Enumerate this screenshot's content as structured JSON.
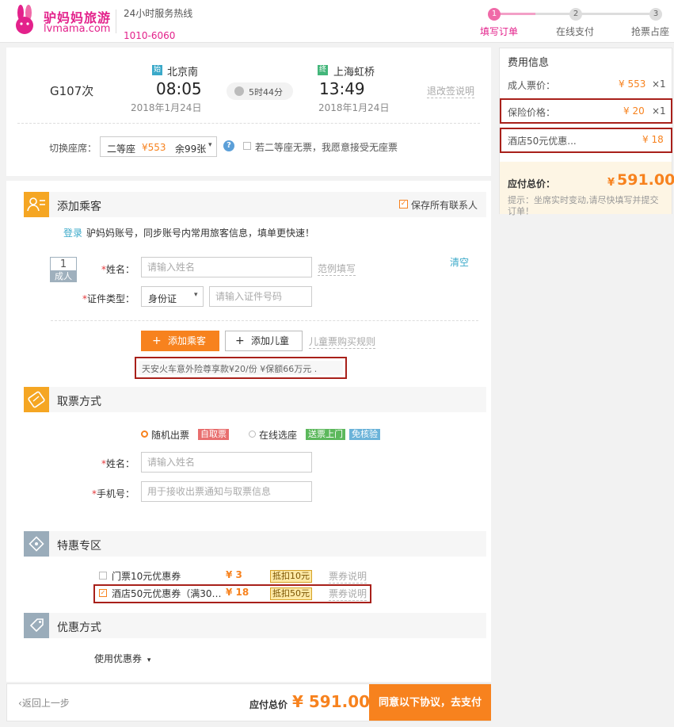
{
  "header": {
    "logo_cn": "驴妈妈旅游",
    "logo_en": "lvmama.com",
    "hotline_label": "24小时服务热线",
    "hotline_number": "1010-6060",
    "steps": [
      {
        "num": "1",
        "label": "填写订单"
      },
      {
        "num": "2",
        "label": "在线支付"
      },
      {
        "num": "3",
        "label": "抢票占座"
      }
    ]
  },
  "train": {
    "number": "G107次",
    "from_station": "北京南",
    "from_badge": "始",
    "depart_time": "08:05",
    "depart_date": "2018年1月24日",
    "duration": "5时44分",
    "to_station": "上海虹桥",
    "to_badge": "终",
    "arrive_time": "13:49",
    "arrive_date": "2018年1月24日",
    "refund_link": "退改签说明",
    "seat_label": "切换座席：",
    "seat_class": "二等座",
    "seat_price": "¥553",
    "seat_remain": "余99张",
    "no_seat_option": "若二等座无票，我愿意接受无座票"
  },
  "passenger": {
    "title": "添加乘客",
    "save_contacts": "保存所有联系人",
    "login_link": "登录",
    "login_hint": "驴妈妈账号，同步账号内常用旅客信息，填单更快速！",
    "index": "1",
    "index_type": "成人",
    "name_label": "姓名：",
    "name_placeholder": "请输入姓名",
    "example_link": "范例填写",
    "clear_link": "清空",
    "id_type_label": "证件类型：",
    "id_type_value": "身份证",
    "id_placeholder": "请输入证件号码",
    "add_passenger_btn": "添加乘客",
    "add_child_btn": "添加儿童",
    "child_rules": "儿童票购买规则",
    "insurance_text": "天安火车意外险尊享款¥20/份   ¥保额66万元 ."
  },
  "ticket": {
    "title": "取票方式",
    "option_random": "随机出票",
    "tag_self": "自取票",
    "option_online": "在线选座",
    "tag_deliver": "送票上门",
    "tag_free": "免核验",
    "name_label": "姓名：",
    "name_placeholder": "请输入姓名",
    "phone_label": "手机号：",
    "phone_placeholder": "用于接收出票通知与取票信息"
  },
  "deals": {
    "title": "特惠专区",
    "items": [
      {
        "name": "门票10元优惠券",
        "price": "¥ 3",
        "tag": "抵扣10元",
        "link": "票券说明"
      },
      {
        "name": "酒店50元优惠券（满30…",
        "price": "¥ 18",
        "tag": "抵扣50元",
        "link": "票券说明"
      }
    ]
  },
  "discount": {
    "title": "优惠方式",
    "coupon_label": "使用优惠券"
  },
  "bottom": {
    "back_link": "返回上一步",
    "total_label": "应付总价",
    "total_value": "¥ 591.00",
    "pay_button": "同意以下协议，去支付"
  },
  "sidebar": {
    "title": "费用信息",
    "rows": [
      {
        "label": "成人票价：",
        "price": "¥ 553",
        "qty": "×1"
      },
      {
        "label": "保险价格：",
        "price": "¥ 20",
        "qty": "×1"
      },
      {
        "label": "酒店50元优惠...",
        "price": "¥ 18",
        "qty": ""
      }
    ],
    "total_label": "应付总价：",
    "total_yen": "¥",
    "total_value": "591.00",
    "hint": "提示：坐席实时变动,请尽快填写并提交订单！"
  },
  "colors": {
    "accent": "#f7821e",
    "brand": "#e3218b",
    "highlight_box": "#a8201a"
  }
}
